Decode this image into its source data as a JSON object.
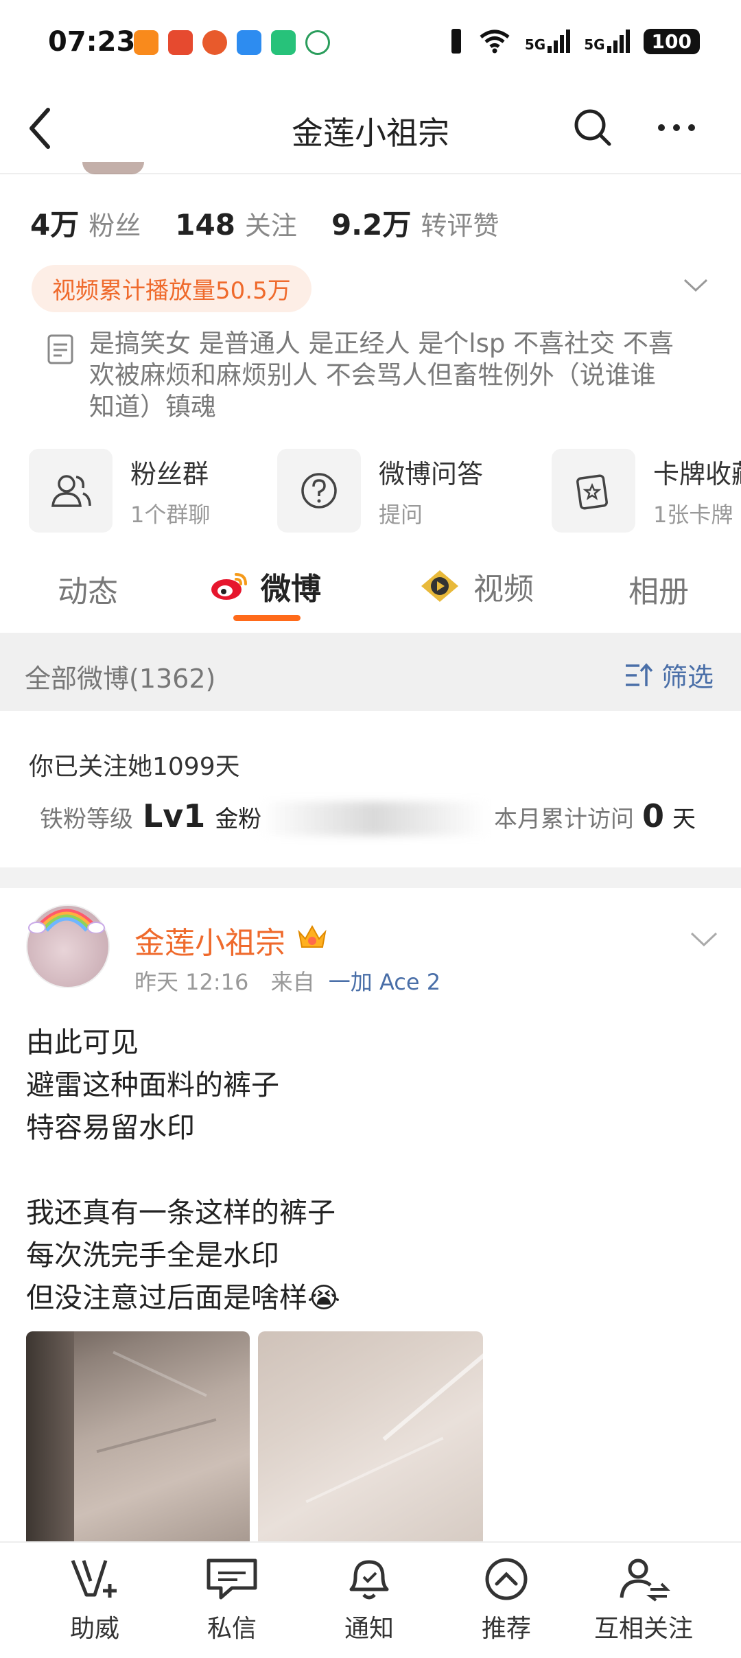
{
  "status_bar": {
    "time": "07:23",
    "network_1": "5G",
    "network_2": "5G",
    "battery": "100"
  },
  "header": {
    "title": "金莲小祖宗",
    "back_icon": "chevron-left-icon",
    "search_icon": "search-icon",
    "more_icon": "more-icon"
  },
  "stats": {
    "followers_num": "4万",
    "followers_label": "粉丝",
    "following_num": "148",
    "following_label": "关注",
    "interactions_num": "9.2万",
    "interactions_label": "转评赞"
  },
  "badge": "视频累计播放量50.5万",
  "bio": "是搞笑女 是普通人 是正经人 是个lsp        不喜社交 不喜欢被麻烦和麻烦别人 不会骂人但畜牲例外（说谁谁知道）镇魂",
  "cards": [
    {
      "title": "粉丝群",
      "sub": "1个群聊",
      "icon": "group-icon"
    },
    {
      "title": "微博问答",
      "sub": "提问",
      "icon": "question-icon"
    },
    {
      "title": "卡牌收藏",
      "sub": "1张卡牌",
      "icon": "card-icon"
    }
  ],
  "tabs": [
    "动态",
    "微博",
    "视频",
    "相册"
  ],
  "filter": {
    "left": "全部微博(1362)",
    "right": "筛选"
  },
  "fan_info": {
    "follow_days": "你已关注她1099天",
    "level_label": "铁粉等级",
    "level_value": "Lv1",
    "level_name": "金粉",
    "month_label": "本月累计访问",
    "month_value": "0",
    "month_unit": "天"
  },
  "post": {
    "author": "金莲小祖宗",
    "time": "昨天 12:16",
    "from_label": "来自",
    "device": "一加 Ace 2",
    "text": "由此可见\n避雷这种面料的裤子\n特容易留水印\n\n我还真有一条这样的裤子\n每次洗完手全是水印\n但没注意过后面是啥样😭"
  },
  "bottom_nav": [
    {
      "label": "助威",
      "icon": "cheer-icon"
    },
    {
      "label": "私信",
      "icon": "message-icon"
    },
    {
      "label": "通知",
      "icon": "bell-icon"
    },
    {
      "label": "推荐",
      "icon": "recommend-icon"
    },
    {
      "label": "互相关注",
      "icon": "mutual-follow-icon"
    }
  ],
  "colors": {
    "accent": "#ef6a2c",
    "link": "#4a6fa8",
    "tab_underline": "#ff6a1a"
  }
}
